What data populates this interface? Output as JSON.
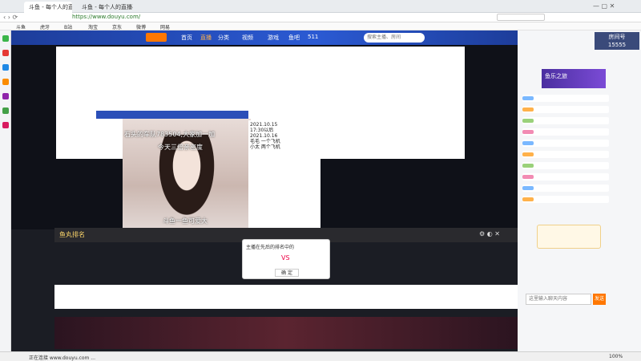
{
  "browser": {
    "tabs": [
      {
        "label": "斗鱼 - 每个人的直播平台"
      },
      {
        "label": "斗鱼 - 每个人的直播平台"
      }
    ],
    "address": "https://www.douyu.com/",
    "bookmarks": [
      "斗鱼",
      "虎牙",
      "B站",
      "淘宝",
      "京东",
      "微博",
      "网易"
    ]
  },
  "site": {
    "nav": [
      "首页",
      "直播",
      "分类",
      "视频",
      "游戏",
      "鱼吧",
      "511"
    ],
    "search_placeholder": "搜索主播、房间",
    "room_id": "15555"
  },
  "stream": {
    "caption_left": "石头的车队783504,大家加一加",
    "caption_sub": "今天三倍亲密度",
    "caption_bottom": "斗鱼一鱼可爱大",
    "schedule": [
      "2021.10.15",
      "17:30以后",
      "2021.10.16",
      "毛毛 一个飞机",
      "小太 两个飞机"
    ],
    "player_title": "鱼丸排名",
    "popup_title": "主播在先后的排名中的",
    "popup_vs": "VS",
    "popup_ok": "确 定"
  },
  "right": {
    "room_label": "房间号",
    "room_value": "15555",
    "banner": "鱼乐之旅",
    "chat_placeholder": "这里输入聊天内容",
    "send": "发送"
  },
  "status": {
    "left": "正在连接 www.douyu.com ...",
    "zoom": "100%"
  },
  "colors": {
    "accent": "#ff7700",
    "header": "#2b5ad3"
  }
}
